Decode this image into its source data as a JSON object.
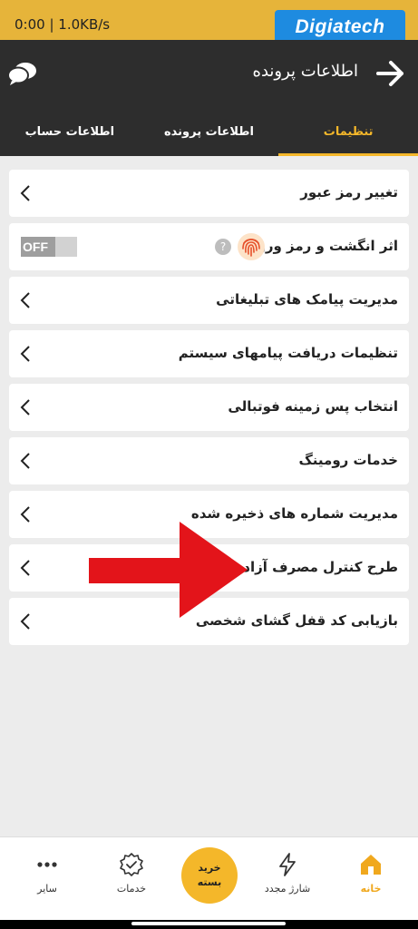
{
  "status_bar": {
    "network": "0:00 | 1.0KB/s",
    "logo_text": "Digiatech"
  },
  "header": {
    "title": "اطلاعات پرونده"
  },
  "tabs": [
    {
      "label": "تنظیمات",
      "active": true
    },
    {
      "label": "اطلاعات پرونده",
      "active": false
    },
    {
      "label": "اطلاعات حساب",
      "active": false
    }
  ],
  "settings": {
    "change_password": "تغییر رمز عبور",
    "fingerprint": {
      "label": "اثر انگشت و رمز ورود",
      "toggle": "OFF",
      "help": "?"
    },
    "ads_sms": "مدیریت پیامک های تبلیغاتی",
    "system_messages": "تنظیمات دریافت پیامهای سیستم",
    "football_bg": "انتخاب پس زمینه فوتبالی",
    "roaming": "خدمات رومینگ",
    "saved_numbers": "مدیریت شماره های ذخیره شده",
    "free_usage": "طرح کنترل مصرف آزاد",
    "unlock_code": "بازیابی کد قفل گشای شخصی"
  },
  "bottom_nav": {
    "home": "خانه",
    "recharge": "شارژ مجدد",
    "buy_line1": "خرید",
    "buy_line2": "بسته",
    "services": "خدمات",
    "other": "سایر"
  },
  "colors": {
    "accent": "#f4b72a",
    "header": "#2d2d2d",
    "arrow": "#e3141a"
  }
}
